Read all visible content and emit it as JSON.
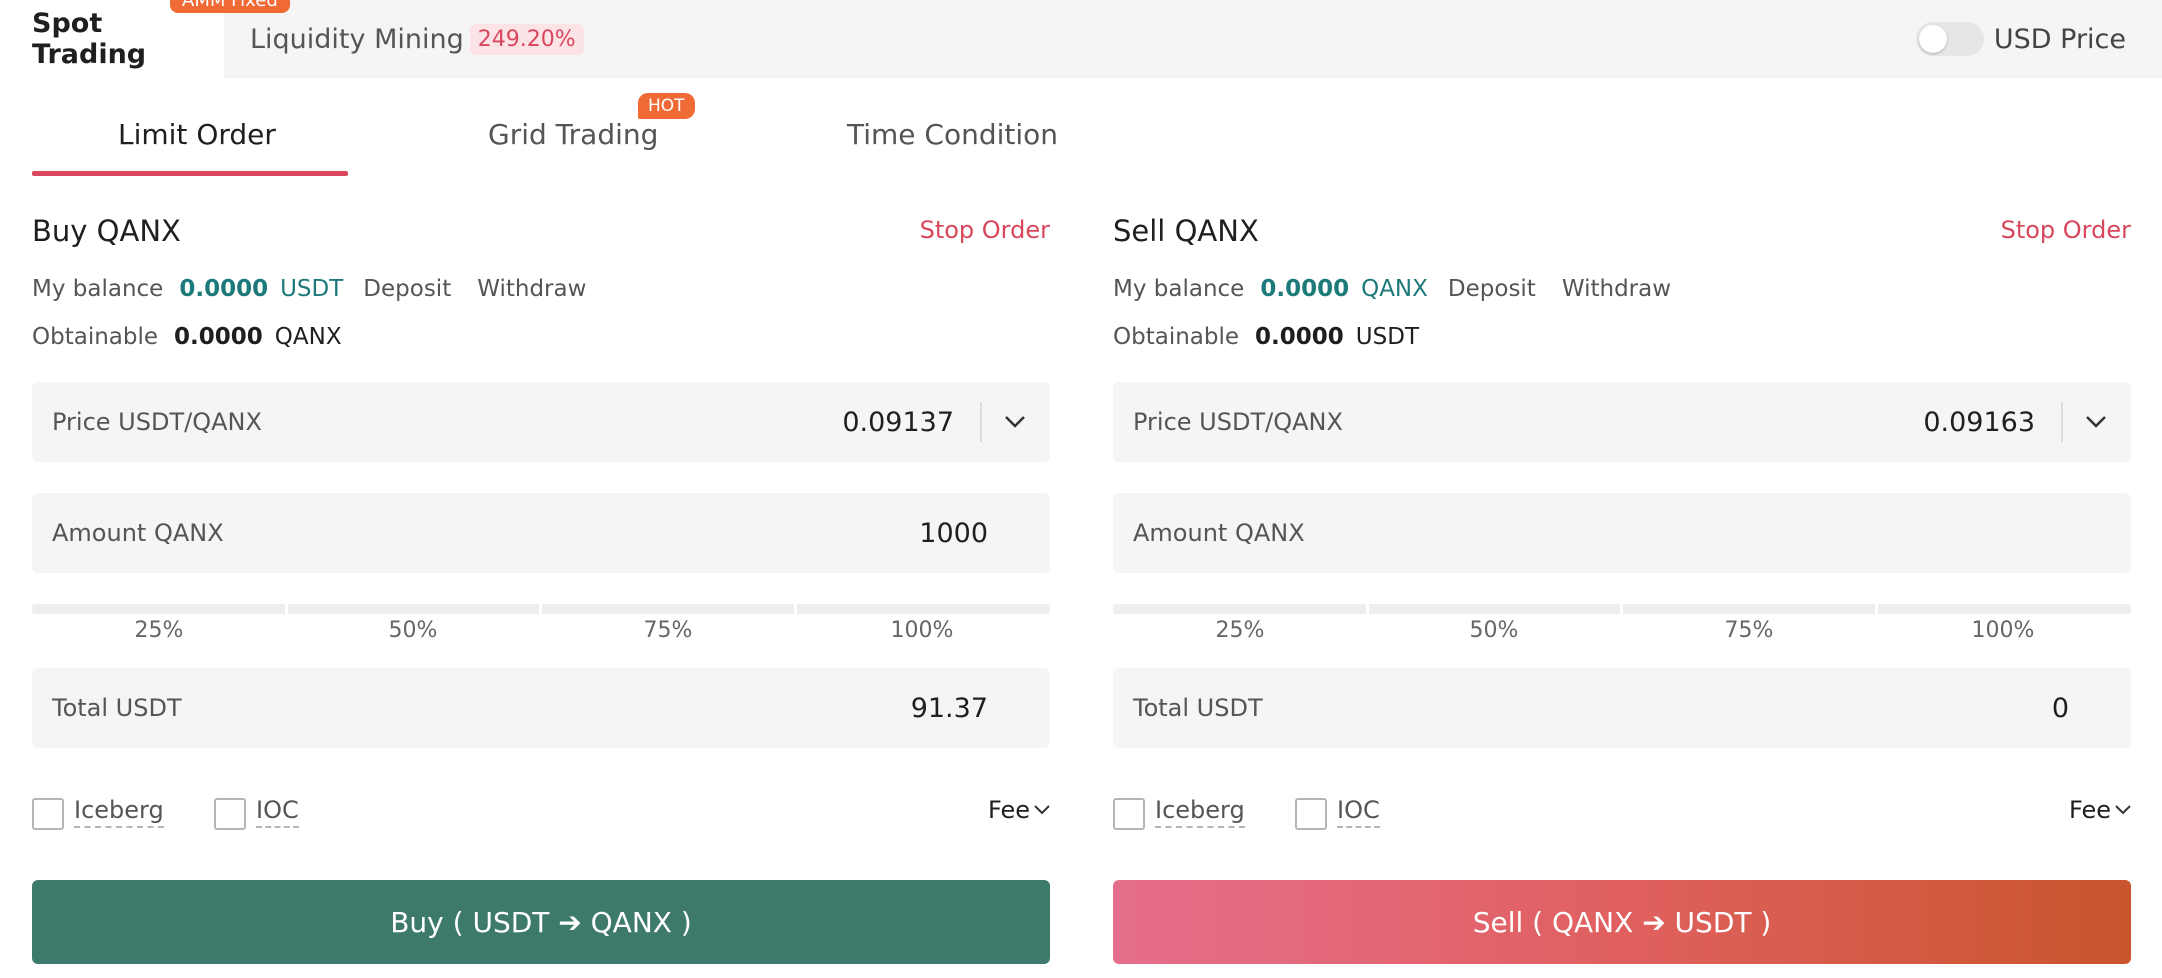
{
  "top_tabs": {
    "spot": "Spot Trading",
    "liquidity": "Liquidity Mining",
    "liquidity_pct": "249.20%",
    "amm_badge": "AMM Fixed",
    "usd_price_label": "USD Price",
    "usd_price_on": false
  },
  "sub_tabs": {
    "limit": "Limit Order",
    "grid": "Grid Trading",
    "grid_badge": "HOT",
    "time": "Time Condition"
  },
  "buy": {
    "title": "Buy QANX",
    "stop_order": "Stop Order",
    "balance_label": "My balance",
    "balance_value": "0.0000",
    "balance_unit": "USDT",
    "deposit": "Deposit",
    "withdraw": "Withdraw",
    "obtainable_label": "Obtainable",
    "obtainable_value": "0.0000",
    "obtainable_unit": "QANX",
    "price_label": "Price USDT/QANX",
    "price_value": "0.09137",
    "amount_label": "Amount QANX",
    "amount_value": "1000",
    "percent_marks": [
      "25%",
      "50%",
      "75%",
      "100%"
    ],
    "total_label": "Total USDT",
    "total_value": "91.37",
    "iceberg": "Iceberg",
    "ioc": "IOC",
    "fee": "Fee",
    "button": "Buy ( USDT ➔ QANX )"
  },
  "sell": {
    "title": "Sell QANX",
    "stop_order": "Stop Order",
    "balance_label": "My balance",
    "balance_value": "0.0000",
    "balance_unit": "QANX",
    "deposit": "Deposit",
    "withdraw": "Withdraw",
    "obtainable_label": "Obtainable",
    "obtainable_value": "0.0000",
    "obtainable_unit": "USDT",
    "price_label": "Price USDT/QANX",
    "price_value": "0.09163",
    "amount_label": "Amount QANX",
    "amount_value": "",
    "percent_marks": [
      "25%",
      "50%",
      "75%",
      "100%"
    ],
    "total_label": "Total USDT",
    "total_value": "0",
    "iceberg": "Iceberg",
    "ioc": "IOC",
    "fee": "Fee",
    "button": "Sell ( QANX ➔ USDT )"
  },
  "colors": {
    "accent_red": "#d9475c",
    "buy_green": "#3e7a6c",
    "balance_teal": "#1e7a7a",
    "badge_orange": "#f06a35"
  },
  "icons": {
    "price_dropdown": "chevron-down-icon",
    "fee_dropdown": "chevron-down-icon"
  }
}
